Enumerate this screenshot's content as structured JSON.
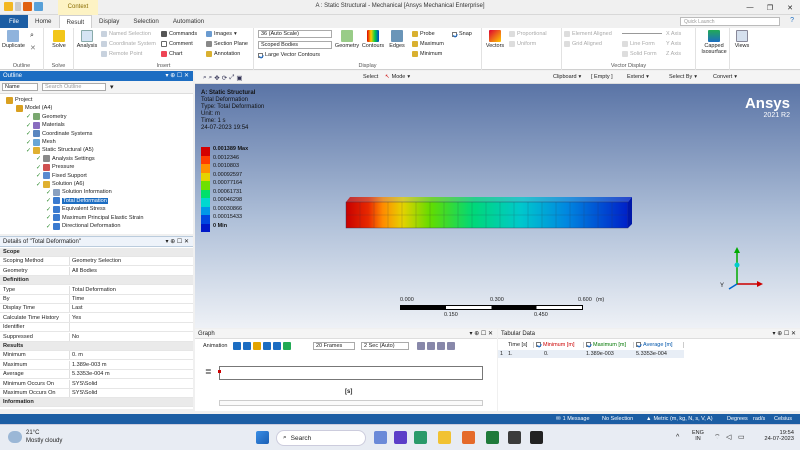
{
  "titlebar": {
    "context_tab": "Context",
    "title": "A : Static Structural - Mechanical [Ansys Mechanical Enterprise]"
  },
  "tabs": [
    "File",
    "Home",
    "Result",
    "Display",
    "Selection",
    "Automation"
  ],
  "quick_launch": {
    "placeholder": "Quick Launch"
  },
  "ribbon": {
    "outline_group": {
      "label": "Outline",
      "duplicate": "Duplicate"
    },
    "solve_group": {
      "label": "Solve",
      "solve": "Solve"
    },
    "insert_group": {
      "label": "Insert",
      "analysis": "Analysis",
      "named_selection": "Named Selection",
      "coordinate_system": "Coordinate System",
      "remote_point": "Remote Point",
      "commands": "Commands",
      "comment": "Comment",
      "chart": "Chart",
      "images": "Images",
      "section_plane": "Section Plane",
      "annotation": "Annotation"
    },
    "display_group": {
      "label": "Display",
      "scale_combo": "36 (Auto Scale)",
      "scope_combo": "Scoped Bodies",
      "contour_combo": "Large Vector Contours",
      "geometry": "Geometry",
      "contours": "Contours",
      "edges": "Edges",
      "probe": "Probe",
      "maximum": "Maximum",
      "minimum": "Minimum",
      "snap": "Snap"
    },
    "vectors_group": {
      "vectors": "Vectors",
      "proportional": "Proportional",
      "uniform": "Uniform"
    },
    "vector_display_group": {
      "label": "Vector Display",
      "element_aligned": "Element Aligned",
      "grid_aligned": "Grid Aligned",
      "line_form": "Line Form",
      "solid_form": "Solid Form",
      "x_axis": "X Axis",
      "y_axis": "Y Axis",
      "z_axis": "Z Axis"
    },
    "capped": {
      "label": "Capped\nIsosurface",
      "label1": "Capped",
      "label2": "Isosurface"
    },
    "views": "Views"
  },
  "outline": {
    "title": "Outline",
    "name_label": "Name",
    "search_placeholder": "Search Outline",
    "tree": [
      {
        "label": "Project",
        "level": 0
      },
      {
        "label": "Model (A4)",
        "level": 1
      },
      {
        "label": "Geometry",
        "level": 2
      },
      {
        "label": "Materials",
        "level": 2
      },
      {
        "label": "Coordinate Systems",
        "level": 2
      },
      {
        "label": "Mesh",
        "level": 2
      },
      {
        "label": "Static Structural (A5)",
        "level": 2
      },
      {
        "label": "Analysis Settings",
        "level": 3
      },
      {
        "label": "Pressure",
        "level": 3
      },
      {
        "label": "Fixed Support",
        "level": 3
      },
      {
        "label": "Solution (A6)",
        "level": 3
      },
      {
        "label": "Solution Information",
        "level": 4
      },
      {
        "label": "Total Deformation",
        "level": 4,
        "selected": true
      },
      {
        "label": "Equivalent Stress",
        "level": 4
      },
      {
        "label": "Maximum Principal Elastic Strain",
        "level": 4
      },
      {
        "label": "Directional Deformation",
        "level": 4
      }
    ]
  },
  "details": {
    "title": "Details of \"Total Deformation\"",
    "rows": [
      {
        "k": "Scope",
        "v": "",
        "section": true
      },
      {
        "k": "Scoping Method",
        "v": "Geometry Selection"
      },
      {
        "k": "Geometry",
        "v": "All Bodies"
      },
      {
        "k": "Definition",
        "v": "",
        "section": true
      },
      {
        "k": "Type",
        "v": "Total Deformation"
      },
      {
        "k": "By",
        "v": "Time"
      },
      {
        "k": "Display Time",
        "v": "Last"
      },
      {
        "k": "Calculate Time History",
        "v": "Yes"
      },
      {
        "k": "Identifier",
        "v": ""
      },
      {
        "k": "Suppressed",
        "v": "No"
      },
      {
        "k": "Results",
        "v": "",
        "section": true
      },
      {
        "k": "Minimum",
        "v": "0. m"
      },
      {
        "k": "Maximum",
        "v": "1.389e-003 m"
      },
      {
        "k": "Average",
        "v": "5.3353e-004 m"
      },
      {
        "k": "Minimum Occurs On",
        "v": "SYS\\Solid"
      },
      {
        "k": "Maximum Occurs On",
        "v": "SYS\\Solid"
      },
      {
        "k": "Information",
        "v": "",
        "section": true
      }
    ]
  },
  "viewer_toolbar": {
    "select": "Select",
    "mode": "Mode",
    "clipboard": "Clipboard",
    "empty": "[ Empty ]",
    "extend": "Extend",
    "select_by": "Select By",
    "convert": "Convert"
  },
  "result_info": {
    "title": "A: Static Structural",
    "line1": "Total Deformation",
    "line2": "Type: Total Deformation",
    "line3": "Unit: m",
    "line4": "Time: 1 s",
    "line5": "24-07-2023 19:54"
  },
  "legend": {
    "labels": [
      "0.001389 Max",
      "0.0012346",
      "0.0010803",
      "0.00092597",
      "0.00077164",
      "0.00061731",
      "0.00046298",
      "0.00030866",
      "0.00015433",
      "0 Min"
    ],
    "colors": [
      "#d40000",
      "#ff3c00",
      "#ff9000",
      "#e5d400",
      "#6ee000",
      "#00e06a",
      "#00d8d0",
      "#0098e8",
      "#0046e0",
      "#0018c8"
    ]
  },
  "branding": {
    "name": "Ansys",
    "version": "2021 R2"
  },
  "scale_bar": {
    "labels": [
      "0.000",
      "0.150",
      "0.300",
      "0.450",
      "0.600"
    ],
    "unit": "(m)"
  },
  "graph": {
    "title": "Graph",
    "animation": "Animation",
    "frames": "20 Frames",
    "duration": "2 Sec (Auto)",
    "axis_label": "[s]"
  },
  "tabular": {
    "title": "Tabular Data",
    "headers": [
      "Time [s]",
      "Minimum [m]",
      "Maximum [m]",
      "Average [m]"
    ],
    "row_index": "1",
    "row": [
      "1.",
      "0.",
      "1.389e-003",
      "5.3353e-004"
    ]
  },
  "statusbar": {
    "messages": "1 Message",
    "selection": "No Selection",
    "units": "Metric (m, kg, N, s, V, A)",
    "degrees": "Degrees",
    "rads": "rad/s",
    "celsius": "Celsius"
  },
  "taskbar": {
    "weather_temp": "21°C",
    "weather_text": "Mostly cloudy",
    "search": "Search",
    "lang1": "ENG",
    "lang2": "IN",
    "time": "19:54",
    "date": "24-07-2023"
  }
}
